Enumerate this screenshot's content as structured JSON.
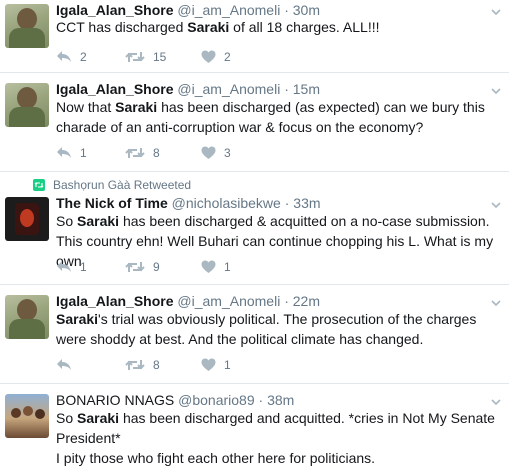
{
  "tweets": [
    {
      "name": "Igala_Alan_Shore",
      "handle": "@i_am_Anomeli",
      "sep": "·",
      "time": "30m",
      "text": {
        "a": "CCT has discharged ",
        "b": "Saraki",
        "c": " of all 18 charges. ALL!!!"
      },
      "replies": "2",
      "retweets": "15",
      "likes": "2"
    },
    {
      "name": "Igala_Alan_Shore",
      "handle": "@i_am_Anomeli",
      "sep": "·",
      "time": "15m",
      "text": {
        "a": "Now that ",
        "b": "Saraki",
        "c": " has been discharged (as expected) can we bury this charade of an anti-corruption war & focus on the economy?"
      },
      "replies": "1",
      "retweets": "8",
      "likes": "3"
    },
    {
      "retweeted_by": "Bashọrun Gàà Retweeted",
      "name": "The Nick of Time",
      "handle": "@nicholasibekwe",
      "sep": "·",
      "time": "33m",
      "text": {
        "a": "So ",
        "b": "Saraki",
        "c": " has been discharged & acquitted on a no-case submission. This country ehn! Well Buhari can continue chopping his L. What is my own"
      },
      "replies": "1",
      "retweets": "9",
      "likes": "1"
    },
    {
      "name": "Igala_Alan_Shore",
      "handle": "@i_am_Anomeli",
      "sep": "·",
      "time": "22m",
      "text": {
        "a": "",
        "b": "Saraki",
        "c": "'s trial was obviously political. The prosecution of the charges were shoddy at best. And the political climate has changed."
      },
      "replies": "",
      "retweets": "8",
      "likes": "1"
    },
    {
      "name": "BONARIO NNAGS",
      "handle": "@bonario89",
      "sep": "·",
      "time": "38m",
      "text": {
        "a": "So ",
        "b": "Saraki",
        "c": " has been discharged and acquitted. *cries in Not My Senate President*"
      },
      "text2": "I pity those who fight each other here for politicians."
    }
  ],
  "colors": {
    "action_grey": "#aab8c2",
    "retweet_green": "#19cf86",
    "text": "#14171a",
    "meta": "#657786"
  },
  "icons": {
    "reply": "reply-icon",
    "retweet": "retweet-icon",
    "like": "heart-icon",
    "more": "chevron-down-icon"
  }
}
